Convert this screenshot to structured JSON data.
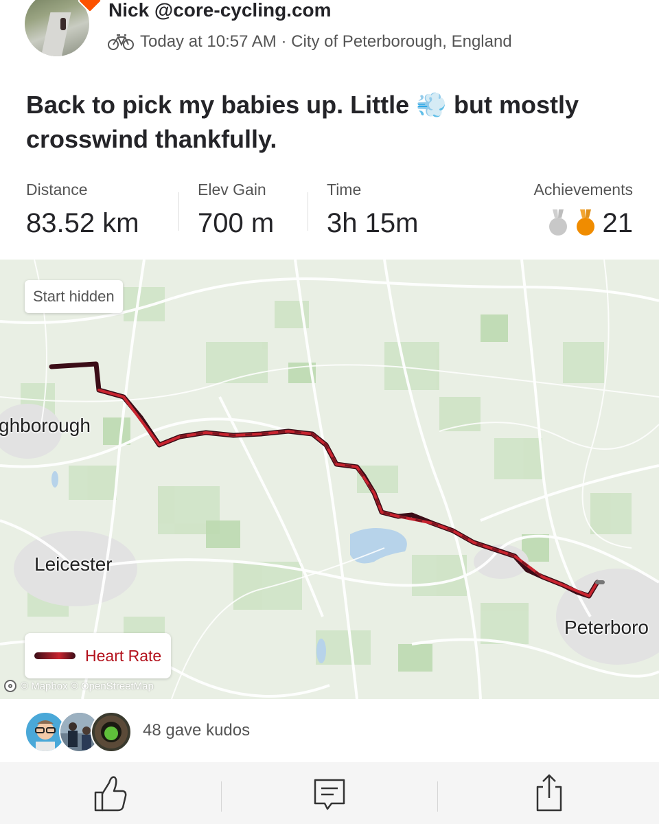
{
  "header": {
    "athlete_name": "Nick @core-cycling.com",
    "timestamp": "Today at 10:57 AM",
    "separator": " · ",
    "location": "City of Peterborough, England",
    "activity_icon": "bike-icon",
    "avatar_icon": "avatar"
  },
  "activity": {
    "title_part1": "Back to pick my babies up. Little ",
    "title_emoji": "💨",
    "title_part2": " but mostly crosswind thankfully."
  },
  "stats": [
    {
      "label": "Distance",
      "value": "83.52 km"
    },
    {
      "label": "Elev Gain",
      "value": "700 m"
    },
    {
      "label": "Time",
      "value": "3h 15m"
    }
  ],
  "achievements": {
    "label": "Achievements",
    "count": "21",
    "medals": [
      "silver-medal-icon",
      "bronze-medal-icon"
    ]
  },
  "map": {
    "start_hidden_label": "Start hidden",
    "places": [
      "ghborough",
      "Leicester",
      "Peterboro"
    ],
    "legend_label": "Heart Rate",
    "attribution": "© Mapbox © OpenStreetMap"
  },
  "kudos": {
    "text": "48 gave kudos"
  },
  "actions": {
    "kudos_icon": "thumbs-up-icon",
    "comment_icon": "comment-icon",
    "share_icon": "share-icon"
  },
  "colors": {
    "route_dark": "#3b0d17",
    "route_red": "#c8242f",
    "legend_text": "#b3111c",
    "brand": "#fc5200"
  }
}
